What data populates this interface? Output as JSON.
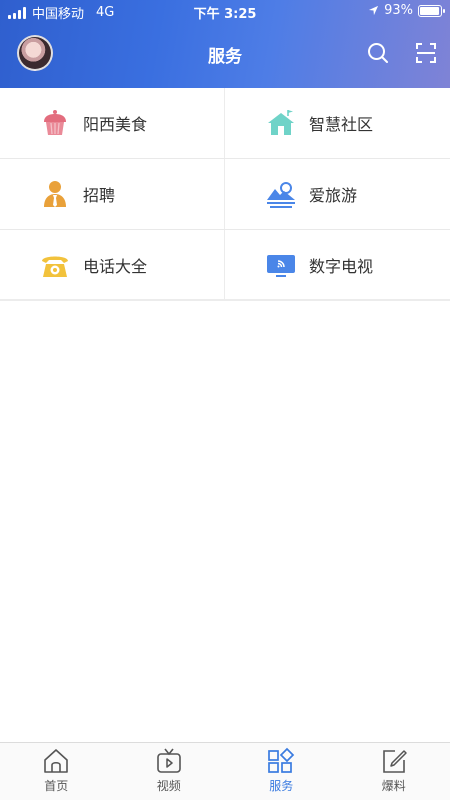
{
  "status_bar": {
    "carrier": "中国移动",
    "network": "4G",
    "time": "下午 3:25",
    "battery": "93%",
    "battery_level": 0.93
  },
  "header": {
    "title": "服务",
    "avatar_icon": "avatar",
    "search_icon": "search-icon",
    "scan_icon": "scan-icon"
  },
  "services": [
    {
      "label": "阳西美食",
      "icon": "cake-icon"
    },
    {
      "label": "智慧社区",
      "icon": "house-icon"
    },
    {
      "label": "招聘",
      "icon": "person-icon"
    },
    {
      "label": "爱旅游",
      "icon": "landscape-icon"
    },
    {
      "label": "电话大全",
      "icon": "telephone-icon"
    },
    {
      "label": "数字电视",
      "icon": "tv-icon"
    }
  ],
  "tabbar": {
    "tabs": [
      {
        "label": "首页",
        "icon": "home-icon"
      },
      {
        "label": "视频",
        "icon": "tv-play-icon"
      },
      {
        "label": "服务",
        "icon": "grid-icon"
      },
      {
        "label": "爆料",
        "icon": "edit-icon"
      }
    ],
    "active": "服务"
  },
  "colors": {
    "accent": "#3a7be0",
    "header_start": "#2f5fce",
    "header_end": "#7f83d6"
  }
}
